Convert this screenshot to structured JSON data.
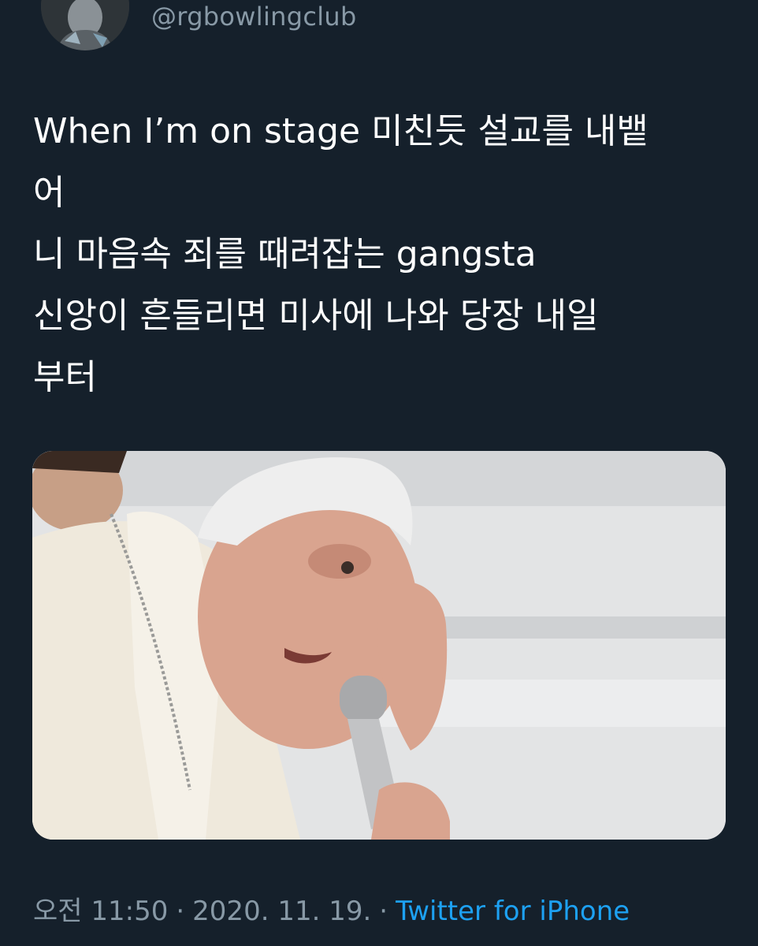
{
  "tweet": {
    "handle": "@rgbowlingclub",
    "text_lines": [
      "When I’m on stage 미친듯 설교를 내뱉",
      "어",
      "니 마음속 죄를 때려잡는 gangsta",
      "신앙이 흔들리면 미사에 나와 당장 내일",
      "부터"
    ],
    "time": "오전 11:50",
    "date": "2020. 11. 19.",
    "separator": "·",
    "source": "Twitter for iPhone"
  },
  "colors": {
    "background": "#15202b",
    "secondary_text": "#8899a6",
    "link": "#1da1f2"
  },
  "media": {
    "kind": "photo",
    "icon": "photo-image"
  }
}
